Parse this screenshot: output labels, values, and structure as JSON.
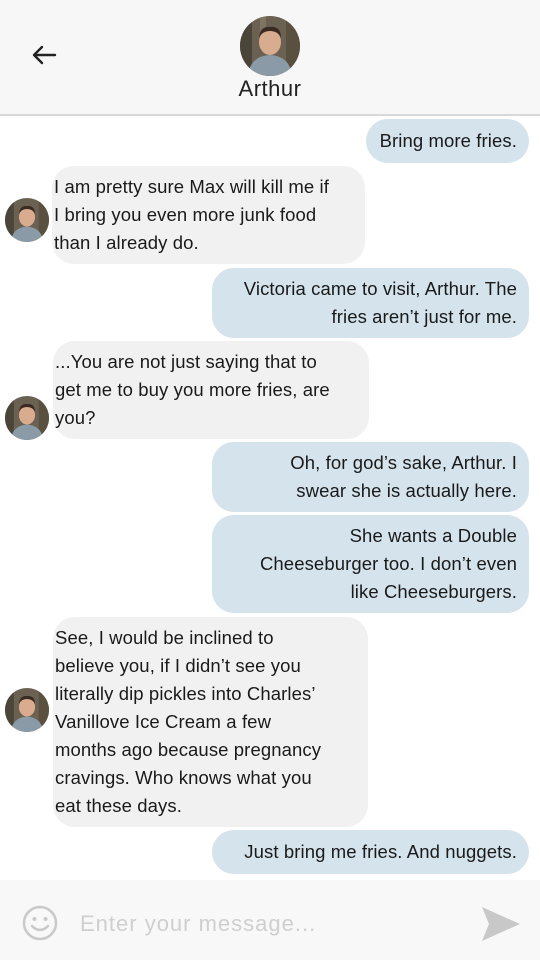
{
  "header": {
    "contact_name": "Arthur",
    "back_icon": "back-arrow-icon"
  },
  "messages": [
    {
      "from": "me",
      "lines": [
        "Bring more fries."
      ]
    },
    {
      "from": "contact",
      "lines": [
        "I am pretty sure Max will kill me if",
        "I bring you even more junk food",
        "than I already do."
      ]
    },
    {
      "from": "me",
      "lines": [
        "Victoria came to visit, Arthur. The",
        "fries aren’t just for me."
      ]
    },
    {
      "from": "contact",
      "lines": [
        "...You are not just saying that to",
        "get me to buy you more fries, are",
        "you?"
      ]
    },
    {
      "from": "me",
      "lines": [
        "Oh, for god’s sake, Arthur. I",
        "swear she is actually here."
      ]
    },
    {
      "from": "me",
      "lines": [
        "She wants a Double",
        "Cheeseburger too. I don’t even",
        "like Cheeseburgers."
      ]
    },
    {
      "from": "contact",
      "lines": [
        "See, I would be inclined to",
        "believe you, if I didn’t see you",
        "literally dip pickles into Charles’",
        "Vanillove Ice Cream a few",
        "months ago because pregnancy",
        "cravings. Who knows what you",
        "eat these days."
      ]
    },
    {
      "from": "me",
      "lines": [
        "Just bring me fries. And nuggets."
      ]
    }
  ],
  "composer": {
    "placeholder": "Enter your message...",
    "value": "",
    "emoji_icon": "smiley-icon",
    "send_icon": "send-icon"
  },
  "colors": {
    "outgoing_bubble": "#d5e3ec",
    "incoming_bubble": "#f1f1f1",
    "header_bg": "#f7f7f7"
  }
}
